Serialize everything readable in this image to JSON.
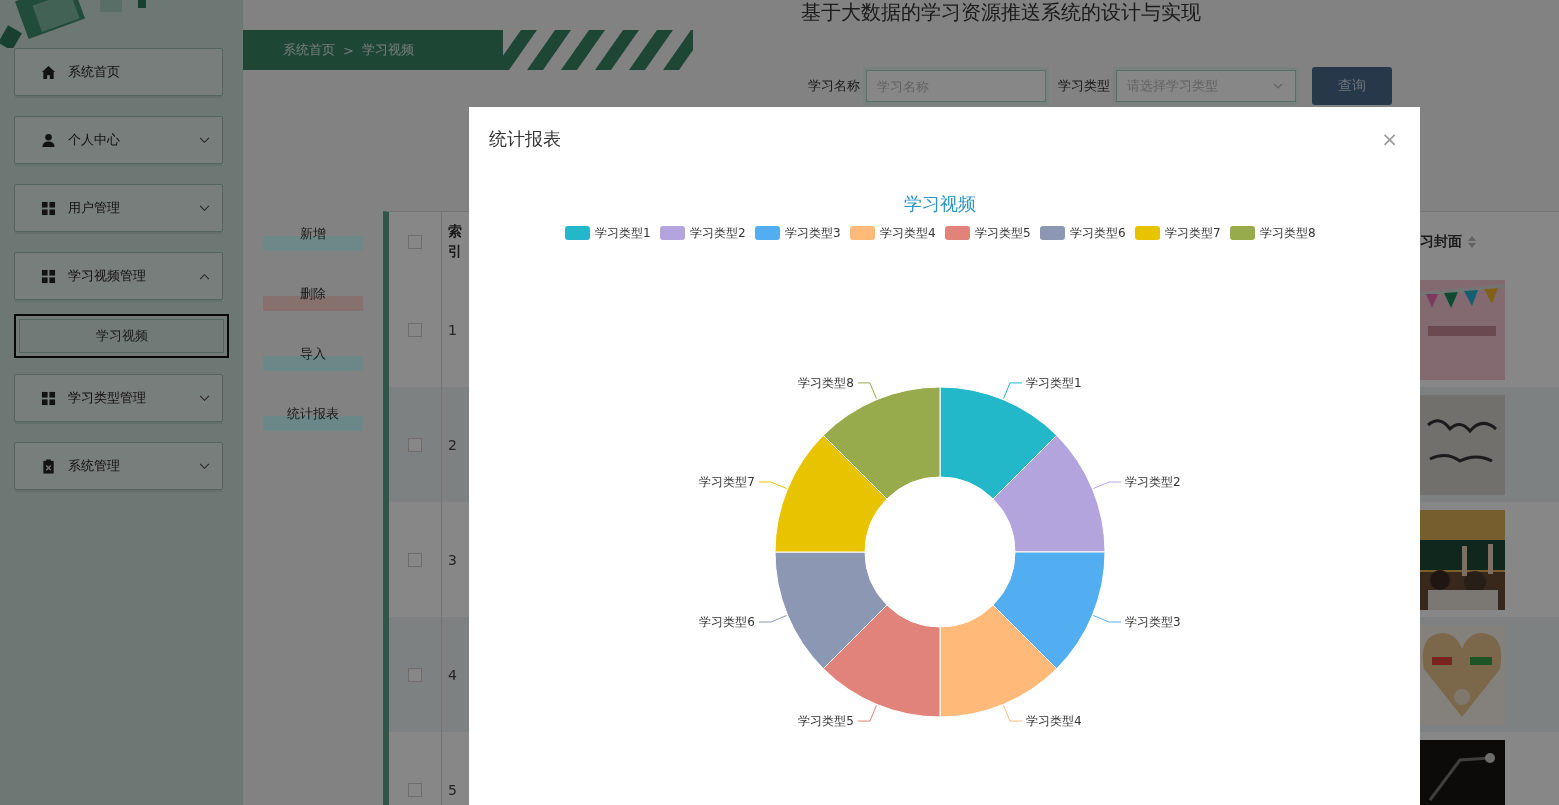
{
  "page_title": "基于大数据的学习资源推送系统的设计与实现",
  "sidebar": {
    "items": [
      {
        "label": "系统首页",
        "kind": "home"
      },
      {
        "label": "个人中心",
        "kind": "person",
        "expanded": false
      },
      {
        "label": "用户管理",
        "kind": "grid",
        "expanded": false
      },
      {
        "label": "学习视频管理",
        "kind": "grid",
        "expanded": true,
        "children": [
          {
            "label": "学习视频",
            "selected": true
          }
        ]
      },
      {
        "label": "学习类型管理",
        "kind": "grid",
        "expanded": false
      },
      {
        "label": "系统管理",
        "kind": "clipboard",
        "expanded": false
      }
    ]
  },
  "breadcrumb": [
    "系统首页",
    ">",
    "学习视频"
  ],
  "search": {
    "fields": [
      {
        "label": "学习名称",
        "kind": "input",
        "placeholder": "学习名称"
      },
      {
        "label": "学习类型",
        "kind": "select",
        "placeholder": "请选择学习类型"
      }
    ],
    "button": "查询"
  },
  "actions": [
    {
      "label": "新增",
      "color": "#6e9489"
    },
    {
      "label": "删除",
      "color": "#86716f"
    },
    {
      "label": "导入",
      "color": "#6c8d91"
    },
    {
      "label": "统计报表",
      "color": "#6c8d91"
    }
  ],
  "table": {
    "columns": [
      "索引",
      "习封面"
    ],
    "all_checked": false,
    "rows": [
      {
        "index": "1",
        "checked": false
      },
      {
        "index": "2",
        "checked": false
      },
      {
        "index": "3",
        "checked": false
      },
      {
        "index": "4",
        "checked": false
      },
      {
        "index": "5",
        "checked": false
      }
    ]
  },
  "dialog": {
    "title": "统计报表",
    "close": "×",
    "chart_data": {
      "type": "donut",
      "title": "学习视频",
      "legend": "top",
      "categories": [
        "学习类型1",
        "学习类型2",
        "学习类型3",
        "学习类型4",
        "学习类型5",
        "学习类型6",
        "学习类型7",
        "学习类型8"
      ],
      "colors": [
        "#22b7c9",
        "#b4a4de",
        "#52aef0",
        "#ffba7a",
        "#e1837a",
        "#8c98b3",
        "#e8c300",
        "#97ab4c"
      ],
      "series": [
        {
          "values": [
            1,
            1,
            1,
            1,
            1,
            1,
            1,
            1
          ]
        }
      ]
    }
  }
}
